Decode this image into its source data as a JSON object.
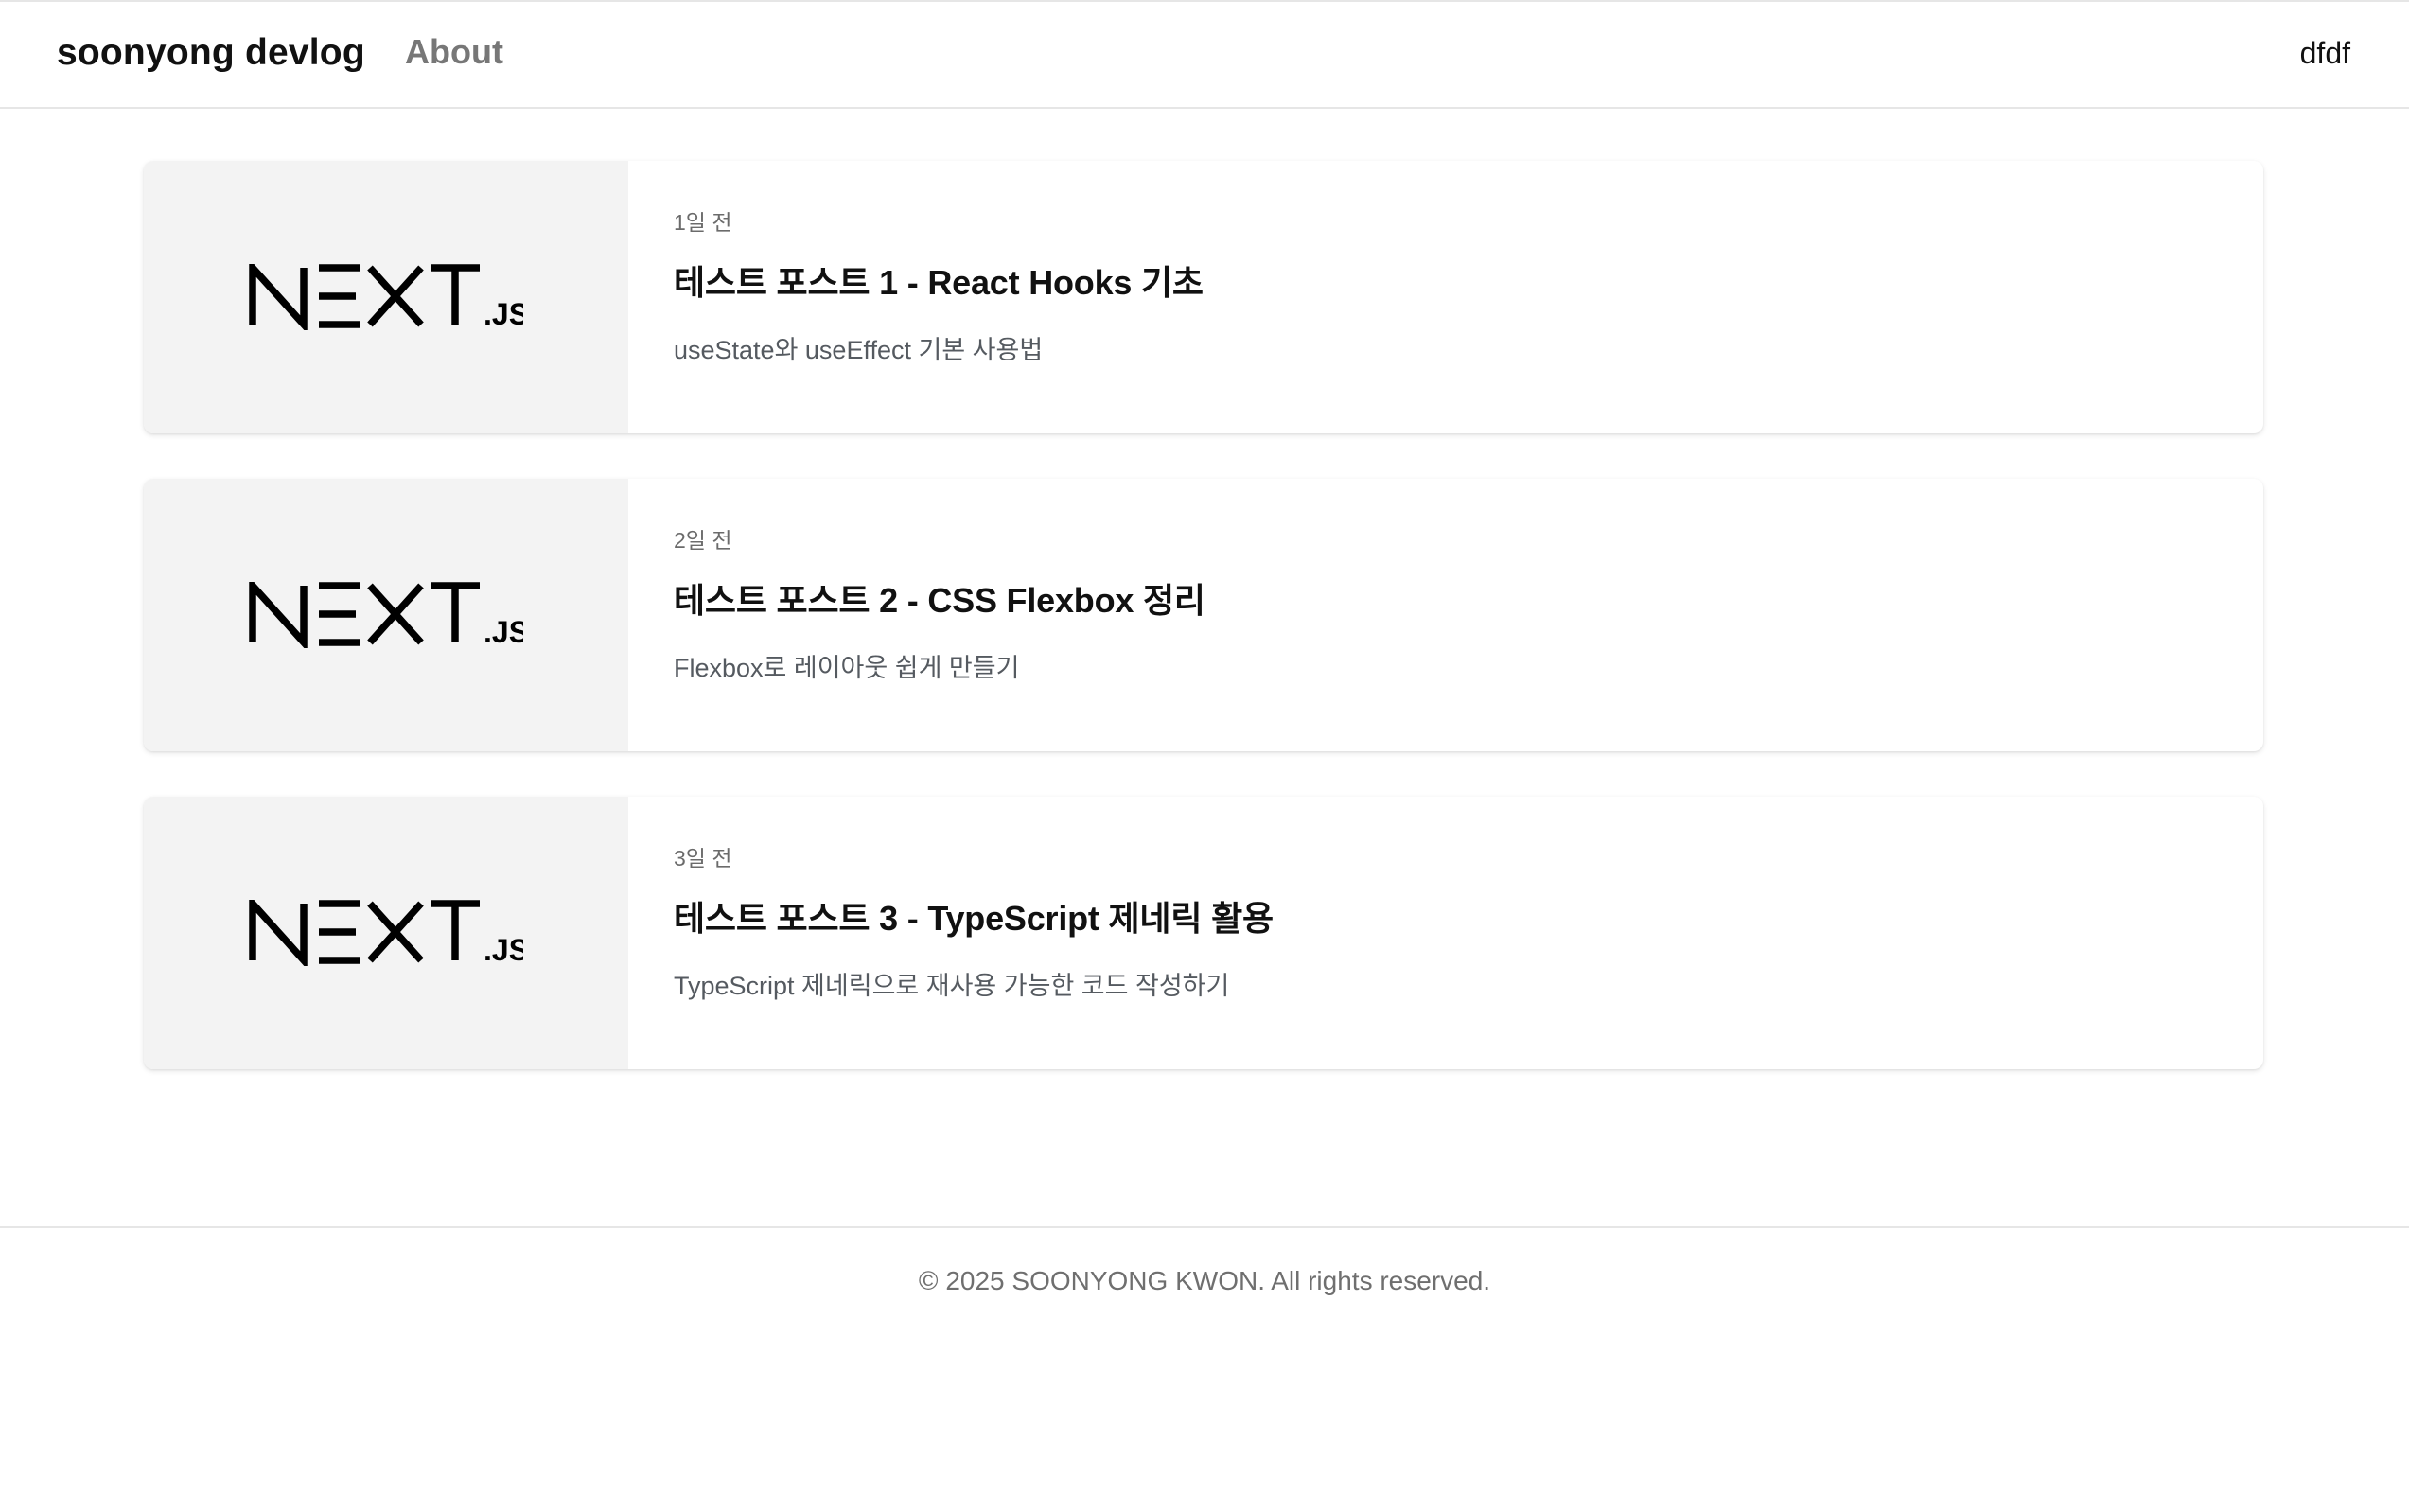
{
  "header": {
    "brand": "soonyong devlog",
    "about": "About",
    "user_menu": "dfdf"
  },
  "posts": [
    {
      "thumbnail": {
        "logo_main": "NEXT",
        "logo_suffix": ".JS"
      },
      "date": "1일 전",
      "title": "테스트 포스트 1 - React Hooks 기초",
      "description": "useState와 useEffect 기본 사용법"
    },
    {
      "thumbnail": {
        "logo_main": "NEXT",
        "logo_suffix": ".JS"
      },
      "date": "2일 전",
      "title": "테스트 포스트 2 - CSS Flexbox 정리",
      "description": "Flexbox로 레이아웃 쉽게 만들기"
    },
    {
      "thumbnail": {
        "logo_main": "NEXT",
        "logo_suffix": ".JS"
      },
      "date": "3일 전",
      "title": "테스트 포스트 3 - TypeScript 제네릭 활용",
      "description": "TypeScript 제네릭으로 재사용 가능한 코드 작성하기"
    }
  ],
  "footer": {
    "copyright": "© 2025 SOONYONG KWON. All rights reserved."
  },
  "colors": {
    "text_primary": "#111111",
    "text_muted": "#6b6b6b",
    "nav_muted": "#777777",
    "thumbnail_bg": "#f3f3f3",
    "divider": "#e6e6e6"
  }
}
